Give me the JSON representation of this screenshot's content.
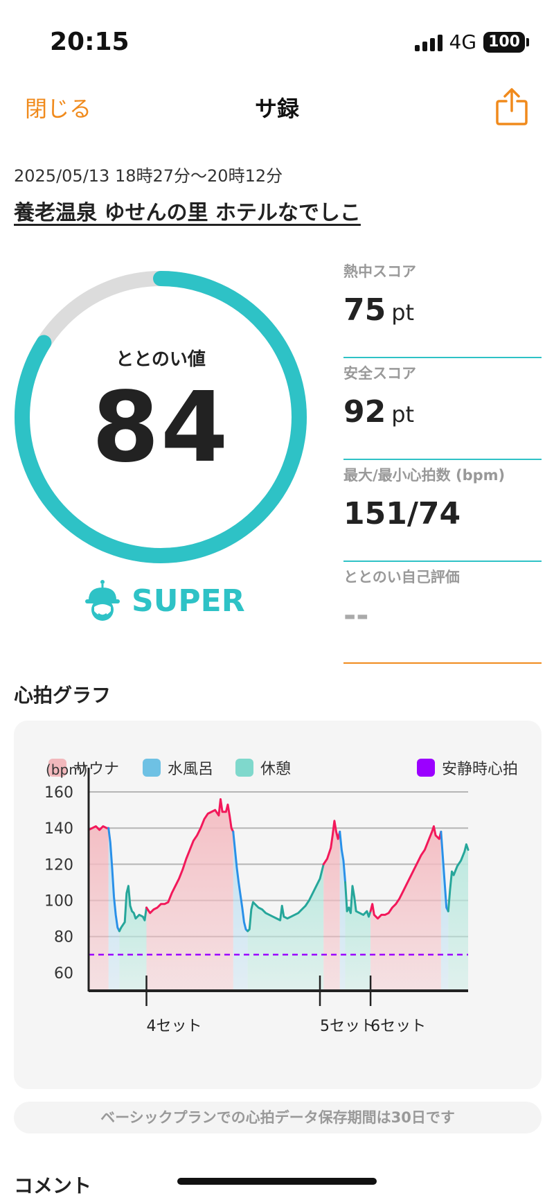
{
  "status_bar": {
    "time": "20:15",
    "network": "4G",
    "battery": "100"
  },
  "nav": {
    "close_label": "閉じる",
    "title": "サ録",
    "share_icon": "share-icon"
  },
  "session": {
    "datetime": "2025/05/13 18時27分〜20時12分",
    "facility": "養老温泉 ゆせんの里 ホテルなでしこ"
  },
  "score": {
    "label": "ととのい値",
    "value": "84",
    "fraction": 0.84,
    "rank": "SUPER",
    "rank_icon": "helmet-character-icon"
  },
  "stats": [
    {
      "label": "熱中スコア",
      "value": "75",
      "unit": "pt"
    },
    {
      "label": "安全スコア",
      "value": "92",
      "unit": "pt"
    },
    {
      "label": "最大/最小心拍数 (bpm)",
      "value": "151/74",
      "unit": ""
    },
    {
      "label": "ととのい自己評価",
      "value": "--",
      "unit": ""
    }
  ],
  "heart_rate": {
    "title": "心拍グラフ",
    "legend": [
      {
        "label": "サウナ",
        "color": "#f2b8bc"
      },
      {
        "label": "水風呂",
        "color": "#6ec1e4"
      },
      {
        "label": "休憩",
        "color": "#7fd8cc"
      },
      {
        "label": "安静時心拍",
        "color": "#9b00ff"
      }
    ],
    "notice": "ベーシックプランでの心拍データ保存期間は30日です"
  },
  "colors": {
    "accent": "#2ec2c6",
    "orange": "#f08a1c",
    "sauna": "#f2185a",
    "cold": "#2a90e8",
    "rest": "#26a69a",
    "resting_hr": "#9b00ff"
  },
  "chart_data": {
    "type": "line",
    "ylabel": "(bpm)",
    "yticks": [
      60,
      80,
      100,
      120,
      140,
      160
    ],
    "ylim": [
      50,
      165
    ],
    "xlim": [
      0,
      105
    ],
    "resting_hr": 70,
    "set_markers": [
      {
        "label": "4セット",
        "x": 16
      },
      {
        "label": "5セット",
        "x": 64
      },
      {
        "label": "6セット",
        "x": 78
      }
    ],
    "segments": [
      {
        "phase": "sauna",
        "points": [
          [
            0,
            139
          ],
          [
            1,
            140
          ],
          [
            2,
            141
          ],
          [
            3,
            139
          ],
          [
            4,
            141
          ],
          [
            5,
            140
          ],
          [
            5.5,
            140
          ]
        ]
      },
      {
        "phase": "cold",
        "points": [
          [
            5.5,
            140
          ],
          [
            6,
            132
          ],
          [
            6.5,
            118
          ],
          [
            7,
            102
          ],
          [
            7.5,
            92
          ],
          [
            8,
            85
          ],
          [
            8.5,
            83
          ]
        ]
      },
      {
        "phase": "rest",
        "points": [
          [
            8.5,
            83
          ],
          [
            9,
            85
          ],
          [
            10,
            88
          ],
          [
            10.5,
            104
          ],
          [
            11,
            108
          ],
          [
            11.5,
            97
          ],
          [
            12,
            94
          ],
          [
            12.5,
            93
          ],
          [
            13,
            90
          ],
          [
            14,
            92
          ],
          [
            15,
            91
          ],
          [
            15.5,
            89
          ],
          [
            16,
            96
          ]
        ]
      },
      {
        "phase": "sauna",
        "points": [
          [
            16,
            96
          ],
          [
            17,
            93
          ],
          [
            18,
            95
          ],
          [
            19,
            96
          ],
          [
            20,
            98
          ],
          [
            21,
            98
          ],
          [
            22,
            99
          ],
          [
            23,
            104
          ],
          [
            24,
            108
          ],
          [
            25,
            112
          ],
          [
            26,
            117
          ],
          [
            27,
            123
          ],
          [
            28,
            128
          ],
          [
            29,
            133
          ],
          [
            30,
            136
          ],
          [
            31,
            140
          ],
          [
            32,
            145
          ],
          [
            33,
            148
          ],
          [
            34,
            149
          ],
          [
            35,
            150
          ],
          [
            36,
            147
          ],
          [
            36.5,
            156
          ],
          [
            37,
            149
          ],
          [
            38,
            149
          ],
          [
            38.5,
            153
          ],
          [
            39,
            147
          ],
          [
            39.5,
            140
          ],
          [
            40,
            138
          ]
        ]
      },
      {
        "phase": "cold",
        "points": [
          [
            40,
            138
          ],
          [
            40.5,
            128
          ],
          [
            41,
            118
          ],
          [
            41.5,
            110
          ],
          [
            42,
            103
          ],
          [
            42.5,
            96
          ],
          [
            43,
            88
          ],
          [
            43.5,
            84
          ],
          [
            44,
            83
          ]
        ]
      },
      {
        "phase": "rest",
        "points": [
          [
            44,
            83
          ],
          [
            44.5,
            84
          ],
          [
            45,
            95
          ],
          [
            45.5,
            99
          ],
          [
            46,
            98
          ],
          [
            47,
            96
          ],
          [
            48,
            95
          ],
          [
            49,
            93
          ],
          [
            50,
            92
          ],
          [
            51,
            91
          ],
          [
            52,
            90
          ],
          [
            53,
            89
          ],
          [
            53.5,
            97
          ],
          [
            54,
            91
          ],
          [
            55,
            90
          ],
          [
            56,
            91
          ],
          [
            57,
            92
          ],
          [
            58,
            93
          ],
          [
            59,
            95
          ],
          [
            60,
            97
          ],
          [
            61,
            100
          ],
          [
            62,
            104
          ],
          [
            63,
            108
          ],
          [
            64,
            112
          ],
          [
            64.5,
            116
          ],
          [
            65,
            120
          ]
        ]
      },
      {
        "phase": "sauna",
        "points": [
          [
            65,
            120
          ],
          [
            66,
            123
          ],
          [
            67,
            129
          ],
          [
            67.5,
            136
          ],
          [
            68,
            144
          ],
          [
            68.5,
            138
          ],
          [
            69,
            134
          ],
          [
            69.5,
            138
          ]
        ]
      },
      {
        "phase": "cold",
        "points": [
          [
            69.5,
            138
          ],
          [
            70,
            128
          ],
          [
            70.5,
            122
          ],
          [
            71,
            110
          ]
        ]
      },
      {
        "phase": "rest",
        "points": [
          [
            71,
            110
          ],
          [
            71.5,
            94
          ],
          [
            72,
            96
          ],
          [
            72.5,
            93
          ],
          [
            73,
            108
          ],
          [
            73.5,
            102
          ],
          [
            74,
            94
          ],
          [
            75,
            93
          ],
          [
            76,
            92
          ],
          [
            77,
            94
          ],
          [
            77.5,
            91
          ],
          [
            78,
            94
          ]
        ]
      },
      {
        "phase": "sauna",
        "points": [
          [
            78,
            94
          ],
          [
            78.5,
            98
          ],
          [
            79,
            92
          ],
          [
            80,
            90
          ],
          [
            81,
            92
          ],
          [
            82,
            92
          ],
          [
            83,
            93
          ],
          [
            84,
            96
          ],
          [
            85,
            98
          ],
          [
            86,
            101
          ],
          [
            87,
            105
          ],
          [
            88,
            109
          ],
          [
            89,
            113
          ],
          [
            90,
            117
          ],
          [
            91,
            121
          ],
          [
            92,
            125
          ],
          [
            93,
            128
          ],
          [
            94,
            133
          ],
          [
            95,
            138
          ],
          [
            95.5,
            141
          ],
          [
            96,
            136
          ],
          [
            97,
            134
          ],
          [
            97.5,
            138
          ]
        ]
      },
      {
        "phase": "cold",
        "points": [
          [
            97.5,
            138
          ],
          [
            98,
            124
          ],
          [
            98.5,
            110
          ],
          [
            99,
            96
          ],
          [
            99.5,
            94
          ]
        ]
      },
      {
        "phase": "rest",
        "points": [
          [
            99.5,
            94
          ],
          [
            100,
            106
          ],
          [
            100.5,
            116
          ],
          [
            101,
            114
          ],
          [
            102,
            119
          ],
          [
            103,
            122
          ],
          [
            104,
            127
          ],
          [
            104.5,
            131
          ],
          [
            105,
            128
          ]
        ]
      }
    ]
  }
}
